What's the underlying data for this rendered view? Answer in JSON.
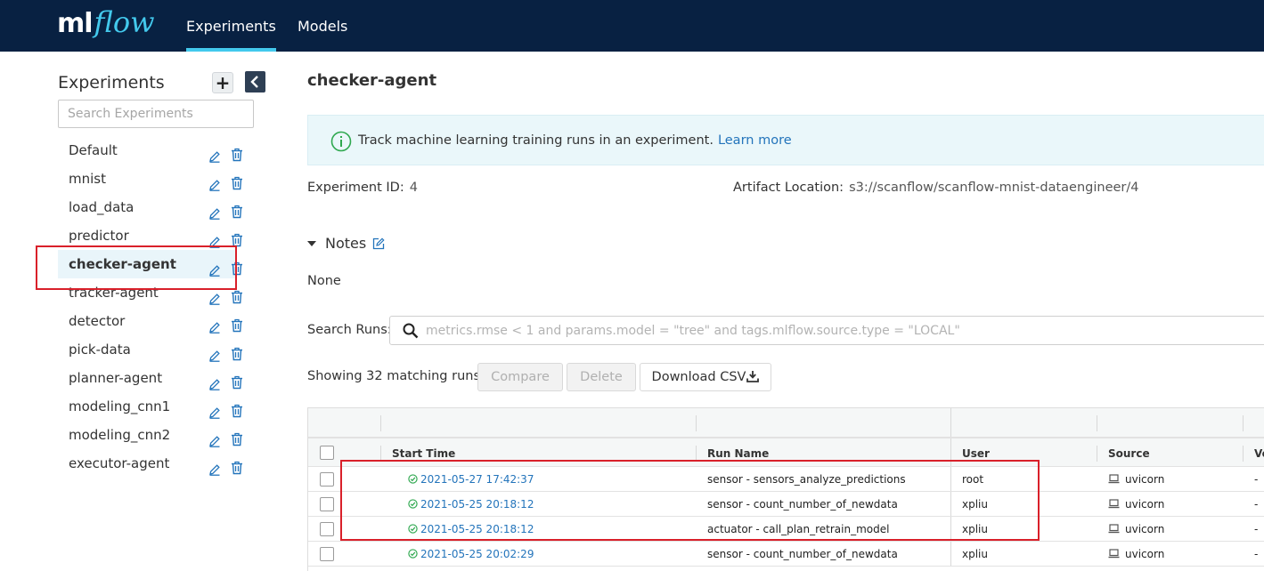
{
  "brand": {
    "ml": "ml",
    "flow": "flow",
    "accent": "#43c9ed",
    "nav_bg": "#082142"
  },
  "nav": {
    "experiments": "Experiments",
    "models": "Models",
    "active": "Experiments"
  },
  "sidebar": {
    "title": "Experiments",
    "add_label": "+",
    "search_placeholder": "Search Experiments",
    "items": [
      {
        "label": "Default"
      },
      {
        "label": "mnist"
      },
      {
        "label": "load_data"
      },
      {
        "label": "predictor"
      },
      {
        "label": "checker-agent",
        "active": true
      },
      {
        "label": "tracker-agent"
      },
      {
        "label": "detector"
      },
      {
        "label": "pick-data"
      },
      {
        "label": "planner-agent"
      },
      {
        "label": "modeling_cnn1"
      },
      {
        "label": "modeling_cnn2"
      },
      {
        "label": "executor-agent"
      }
    ]
  },
  "main": {
    "title": "checker-agent",
    "banner": {
      "text": "Track machine learning training runs in an experiment.",
      "link": "Learn more"
    },
    "experiment_id_label": "Experiment ID:",
    "experiment_id": "4",
    "artifact_label": "Artifact Location:",
    "artifact_location": "s3://scanflow/scanflow-mnist-dataengineer/4",
    "notes_label": "Notes",
    "notes_value": "None",
    "search_runs_label": "Search Runs:",
    "search_runs_placeholder": "metrics.rmse < 1 and params.model = \"tree\" and tags.mlflow.source.type = \"LOCAL\"",
    "showing": "Showing 32 matching runs",
    "compare_label": "Compare",
    "delete_label": "Delete",
    "download_label": "Download CSV"
  },
  "table": {
    "columns": [
      "Start Time",
      "Run Name",
      "User",
      "Source",
      "Ve"
    ],
    "rows": [
      {
        "start_time": "2021-05-27 17:42:37",
        "run_name": "sensor - sensors_analyze_predictions",
        "user": "root",
        "source": "uvicorn",
        "version": "-"
      },
      {
        "start_time": "2021-05-25 20:18:12",
        "run_name": "sensor - count_number_of_newdata",
        "user": "xpliu",
        "source": "uvicorn",
        "version": "-"
      },
      {
        "start_time": "2021-05-25 20:18:12",
        "run_name": "actuator - call_plan_retrain_model",
        "user": "xpliu",
        "source": "uvicorn",
        "version": "-"
      },
      {
        "start_time": "2021-05-25 20:02:29",
        "run_name": "sensor - count_number_of_newdata",
        "user": "xpliu",
        "source": "uvicorn",
        "version": "-"
      }
    ]
  },
  "colors": {
    "link": "#2374bb",
    "success": "#2fa84f",
    "annotation": "#d9202a"
  }
}
